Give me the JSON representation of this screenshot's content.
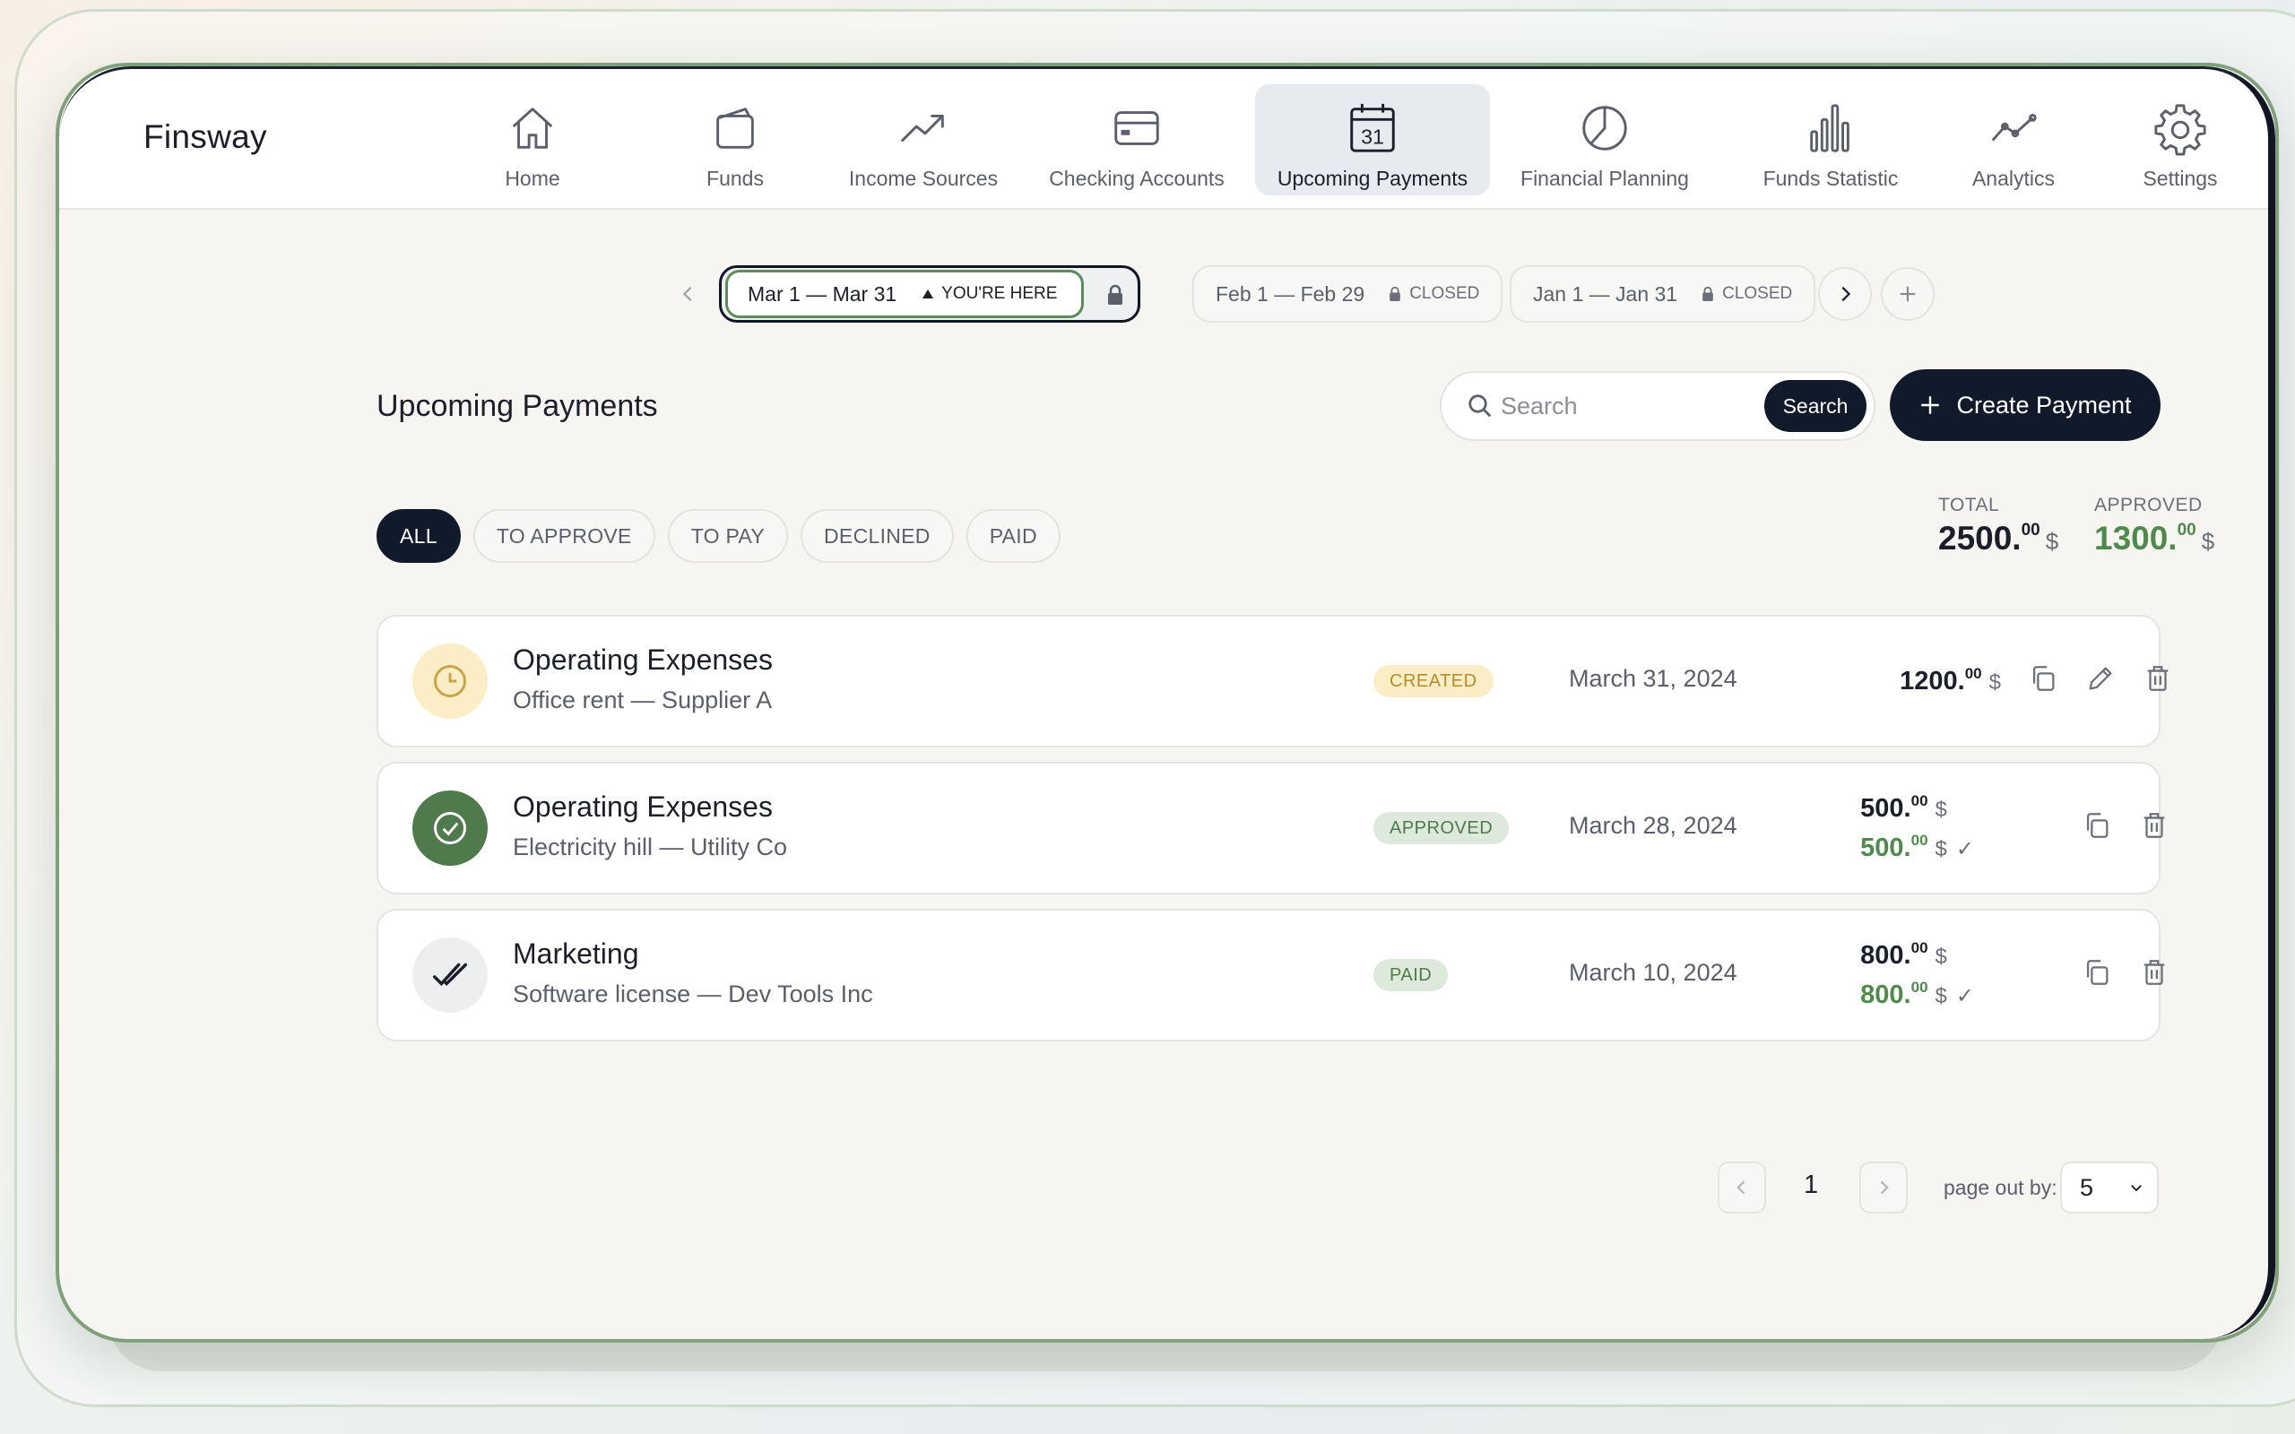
{
  "app": {
    "brand": "Finsway"
  },
  "nav": [
    {
      "label": "Home",
      "icon": "home-icon"
    },
    {
      "label": "Funds",
      "icon": "wallet-icon"
    },
    {
      "label": "Income Sources",
      "icon": "trend-up-icon"
    },
    {
      "label": "Checking Accounts",
      "icon": "card-icon"
    },
    {
      "label": "Upcoming Payments",
      "icon": "calendar-icon",
      "calendar_day": "31",
      "active": true
    },
    {
      "label": "Financial Planning",
      "icon": "pie-chart-icon"
    },
    {
      "label": "Funds Statistic",
      "icon": "bar-chart-icon"
    },
    {
      "label": "Analytics",
      "icon": "line-chart-icon"
    },
    {
      "label": "Settings",
      "icon": "gear-icon"
    }
  ],
  "periods": {
    "current": {
      "label": "Mar 1 — Mar 31",
      "marker": "YOU'RE HERE"
    },
    "others": [
      {
        "label": "Feb 1 — Feb 29",
        "status": "CLOSED"
      },
      {
        "label": "Jan 1 — Jan 31",
        "status": "CLOSED"
      }
    ]
  },
  "page": {
    "title": "Upcoming Payments",
    "search_placeholder": "Search",
    "search_button": "Search",
    "create_button": "Create Payment"
  },
  "filters": [
    "ALL",
    "TO APPROVE",
    "TO PAY",
    "DECLINED",
    "PAID"
  ],
  "active_filter": "ALL",
  "totals": {
    "total": {
      "label": "TOTAL",
      "int": "2500.",
      "dec": "00",
      "currency": "$"
    },
    "approved": {
      "label": "APPROVED",
      "int": "1300.",
      "dec": "00",
      "currency": "$"
    }
  },
  "payments": [
    {
      "title": "Operating Expenses",
      "subtitle": "Office rent — Supplier A",
      "status": "CREATED",
      "date": "March 31, 2024",
      "amount_int": "1200.",
      "amount_dec": "00",
      "currency": "$",
      "icon": "clock-icon"
    },
    {
      "title": "Operating Expenses",
      "subtitle": "Electricity hill — Utility Co",
      "status": "APPROVED",
      "date": "March 28, 2024",
      "amount_int": "500.",
      "amount_dec": "00",
      "currency": "$",
      "approved_int": "500.",
      "approved_dec": "00",
      "approved_mark": "✓",
      "icon": "check-circle-icon"
    },
    {
      "title": "Marketing",
      "subtitle": "Software license — Dev Tools Inc",
      "status": "PAID",
      "date": "March 10, 2024",
      "amount_int": "800.",
      "amount_dec": "00",
      "currency": "$",
      "approved_int": "800.",
      "approved_dec": "00",
      "approved_mark": "✓",
      "icon": "double-check-icon"
    }
  ],
  "pagination": {
    "page": "1",
    "page_out_label": "page out by:",
    "page_size": "5"
  },
  "colors": {
    "primary": "#111a2b",
    "green": "#4f8a4c",
    "created_bg": "#fbeec6",
    "approved_bg": "#dde9da"
  }
}
